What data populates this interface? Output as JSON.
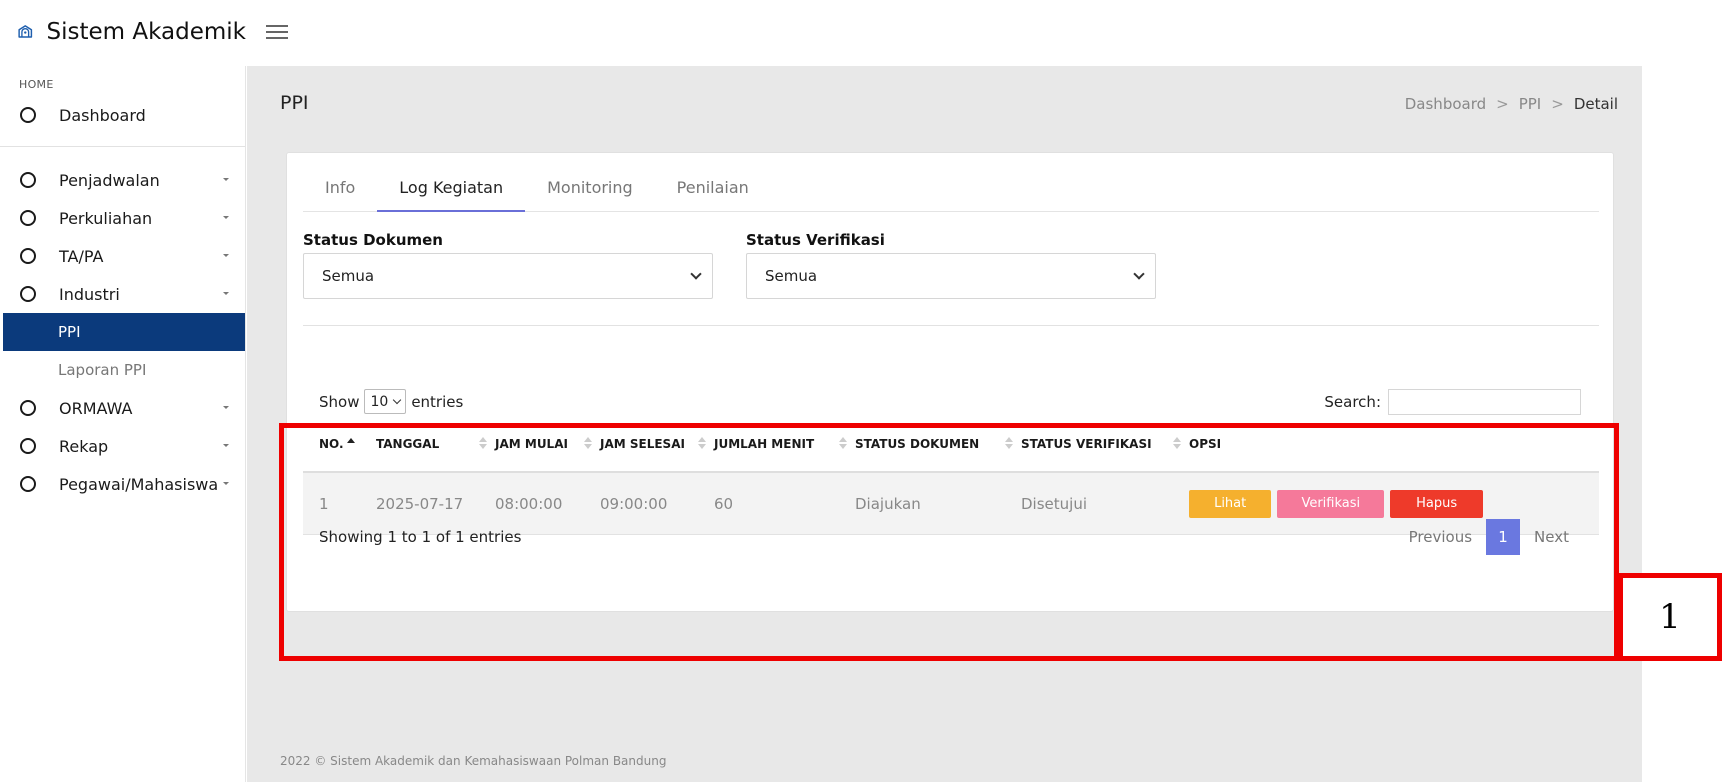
{
  "app": {
    "title": "Sistem Akademik"
  },
  "sidebar": {
    "heading": "HOME",
    "top_item": "Dashboard",
    "items": [
      {
        "label": "Penjadwalan"
      },
      {
        "label": "Perkuliahan"
      },
      {
        "label": "TA/PA"
      },
      {
        "label": "Industri"
      },
      {
        "label": "ORMAWA"
      },
      {
        "label": "Rekap"
      },
      {
        "label": "Pegawai/Mahasiswa"
      }
    ],
    "subitems": [
      {
        "label": "PPI",
        "active": true
      },
      {
        "label": "Laporan PPI",
        "active": false
      }
    ]
  },
  "page": {
    "title": "PPI",
    "breadcrumb": [
      "Dashboard",
      "PPI",
      "Detail"
    ],
    "breadcrumb_sep": ">"
  },
  "tabs": [
    "Info",
    "Log Kegiatan",
    "Monitoring",
    "Penilaian"
  ],
  "active_tab": "Log Kegiatan",
  "filters": {
    "status_dokumen": {
      "label": "Status Dokumen",
      "value": "Semua"
    },
    "status_verifikasi": {
      "label": "Status Verifikasi",
      "value": "Semua"
    }
  },
  "table_controls": {
    "show": "Show",
    "entries_value": "10",
    "entries": "entries",
    "search_label": "Search:",
    "search_value": ""
  },
  "table": {
    "headers": [
      "NO.",
      "TANGGAL",
      "JAM MULAI",
      "JAM SELESAI",
      "JUMLAH MENIT",
      "STATUS DOKUMEN",
      "STATUS VERIFIKASI",
      "OPSI"
    ],
    "rows": [
      {
        "no": "1",
        "tanggal": "2025-07-17",
        "jam_mulai": "08:00:00",
        "jam_selesai": "09:00:00",
        "jumlah_menit": "60",
        "status_dokumen": "Diajukan",
        "status_verifikasi": "Disetujui"
      }
    ],
    "actions": {
      "lihat": "Lihat",
      "verifikasi": "Verifikasi",
      "hapus": "Hapus"
    }
  },
  "pagination": {
    "info": "Showing 1 to 1 of 1 entries",
    "previous": "Previous",
    "current": "1",
    "next": "Next"
  },
  "footer": "2022 © Sistem Akademik dan Kemahasiswaan Polman Bandung",
  "annotation": {
    "label": "1"
  },
  "colors": {
    "sidebar_active": "#0b3a7c",
    "tab_accent": "#6a6fd8",
    "btn_lihat": "#f5b02e",
    "btn_verifikasi": "#f5799a",
    "btn_hapus": "#ee3a2a",
    "highlight": "#ee0000"
  }
}
